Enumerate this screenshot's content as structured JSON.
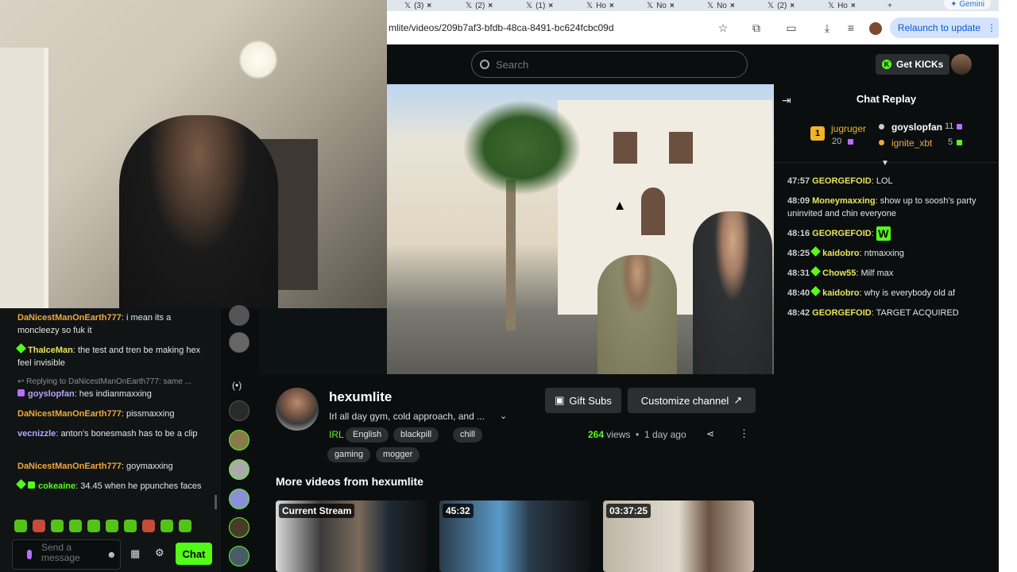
{
  "browser": {
    "tabs": [
      {
        "icon": "x-logo-icon",
        "label": "(3)"
      },
      {
        "icon": "x-logo-icon",
        "label": "(2)"
      },
      {
        "icon": "x-logo-icon",
        "label": "(1)"
      },
      {
        "icon": "x-logo-icon",
        "label": "Ho"
      },
      {
        "icon": "x-logo-icon",
        "label": "No"
      },
      {
        "icon": "x-logo-icon",
        "label": "No"
      },
      {
        "icon": "x-logo-icon",
        "label": "(2)"
      },
      {
        "icon": "x-logo-icon",
        "label": "Ho"
      }
    ],
    "gemini_label": "Gemini",
    "url": "mlite/videos/209b7af3-bfdb-48ca-8491-bc624fcbc09d",
    "relaunch_label": "Relaunch to update"
  },
  "site": {
    "search_placeholder": "Search",
    "get_kicks_label": "Get KICKs",
    "accent": "#53fc18"
  },
  "channel": {
    "name": "hexumlite",
    "stream_title": "Irl all day gym, cold approach, and ...",
    "category": "IRL",
    "tags": [
      "English",
      "blackpill",
      "chill",
      "gaming",
      "mogger"
    ],
    "gift_subs_label": "Gift Subs",
    "customize_label": "Customize channel",
    "views_count": "264",
    "views_label": "views",
    "age": "1 day ago",
    "more_videos_heading": "More videos from hexumlite",
    "thumbnails": [
      {
        "badge": "Current Stream"
      },
      {
        "badge": "45:32"
      },
      {
        "badge": "03:37:25"
      }
    ]
  },
  "left_chat": {
    "messages": [
      {
        "user": "DaNicestManOnEarth777",
        "text": "i mean its a moncleezy so fuk it"
      },
      {
        "user": "ThaIceMan",
        "text": "the test and tren be making hex feel invisible"
      },
      {
        "reply": "Replying to DaNicestManOnEarth777: same ..."
      },
      {
        "user": "goyslopfan",
        "text": "hes indianmaxxing"
      },
      {
        "user": "DaNicestManOnEarth777",
        "text": "pissmaxxing"
      },
      {
        "user": "vecnizzle",
        "text": "anton's bonesmash has to be a clip"
      },
      {
        "user": "DaNicestManOnEarth777",
        "text": "goymaxxing"
      },
      {
        "user": "cokeaine",
        "text": "34.45 when he ppunches faces"
      }
    ],
    "input_placeholder": "Send a message",
    "chat_button": "Chat"
  },
  "replay": {
    "title": "Chat Replay",
    "leaderboard": [
      {
        "rank": "1",
        "user": "jugruger",
        "count": "20"
      },
      {
        "user": "goyslopfan",
        "count": "11"
      },
      {
        "user": "ignite_xbt",
        "count": "5"
      }
    ],
    "messages": [
      {
        "time": "47:57",
        "user": "GEORGEFOID",
        "text": "LOL"
      },
      {
        "time": "48:09",
        "user": "Moneymaxxing",
        "text": "show up to soosh's party uninvited and chin everyone"
      },
      {
        "time": "48:16",
        "user": "GEORGEFOID",
        "text": "",
        "emote": "W"
      },
      {
        "time": "48:25",
        "user": "kaidobro",
        "text": "ntmaxxing"
      },
      {
        "time": "48:31",
        "user": "Chow55",
        "text": "Milf max"
      },
      {
        "time": "48:40",
        "user": "kaidobro",
        "text": "why is everybody old af"
      },
      {
        "time": "48:42",
        "user": "GEORGEFOID",
        "text": "TARGET ACQUIRED"
      }
    ]
  }
}
